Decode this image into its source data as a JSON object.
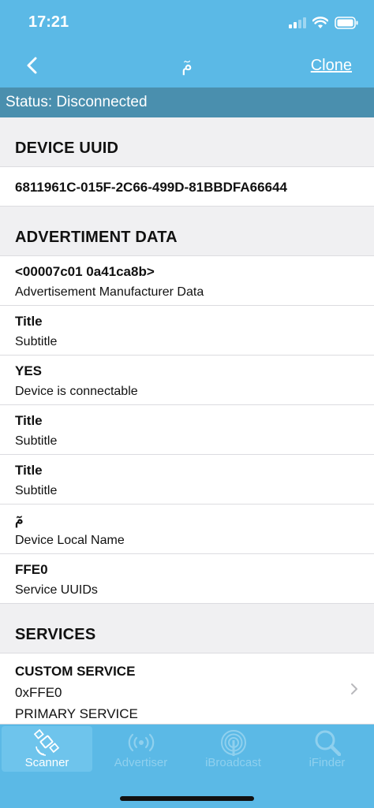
{
  "status_bar": {
    "time": "17:21"
  },
  "nav": {
    "title": "مٓ",
    "action_label": "Clone"
  },
  "connection_status": "Status: Disconnected",
  "sections": {
    "uuid": {
      "header": "DEVICE UUID",
      "value": "6811961C-015F-2C66-499D-81BBDFA66644"
    },
    "adv": {
      "header": "ADVERTIMENT DATA",
      "items": [
        {
          "title": "<00007c01 0a41ca8b>",
          "subtitle": "Advertisement Manufacturer Data"
        },
        {
          "title": "Title",
          "subtitle": "Subtitle"
        },
        {
          "title": "YES",
          "subtitle": "Device is connectable"
        },
        {
          "title": "Title",
          "subtitle": "Subtitle"
        },
        {
          "title": "Title",
          "subtitle": "Subtitle"
        },
        {
          "title": "مٓ",
          "subtitle": "Device Local Name"
        },
        {
          "title": "FFE0",
          "subtitle": "Service UUIDs"
        }
      ]
    },
    "services": {
      "header": "SERVICES",
      "items": [
        {
          "name": "CUSTOM SERVICE",
          "uuid": "0xFFE0",
          "type": "PRIMARY SERVICE"
        }
      ]
    }
  },
  "tabs": [
    {
      "label": "Scanner",
      "icon": "satellite-icon",
      "active": true
    },
    {
      "label": "Advertiser",
      "icon": "broadcast-icon",
      "active": false
    },
    {
      "label": "iBroadcast",
      "icon": "beacon-icon",
      "active": false
    },
    {
      "label": "iFinder",
      "icon": "magnifier-icon",
      "active": false
    }
  ],
  "colors": {
    "bar": "#5bb9e6",
    "status_strip": "#4a8fae",
    "background": "#f0f0f2"
  }
}
